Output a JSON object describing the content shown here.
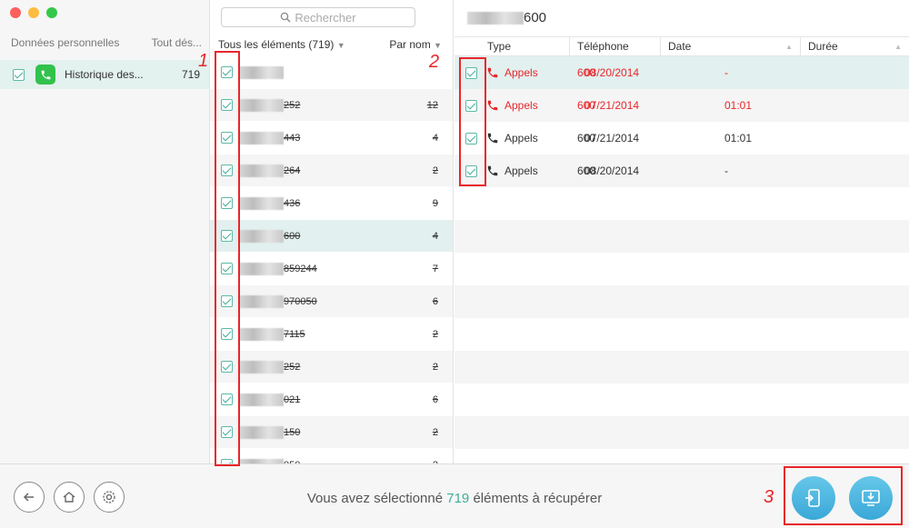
{
  "left": {
    "header_left": "Données personnelles",
    "header_right": "Tout dés...",
    "item": {
      "label": "Historique des...",
      "count": "719"
    }
  },
  "middle": {
    "search_placeholder": "Rechercher",
    "filter_label": "Tous les éléments (719)",
    "sort_label": "Par nom",
    "rows": [
      {
        "num": "",
        "count": ""
      },
      {
        "num": "252",
        "count": "12"
      },
      {
        "num": "443",
        "count": "4"
      },
      {
        "num": "264",
        "count": "2"
      },
      {
        "num": "436",
        "count": "9"
      },
      {
        "num": "600",
        "count": "4"
      },
      {
        "num": "859244",
        "count": "7"
      },
      {
        "num": "970050",
        "count": "6"
      },
      {
        "num": "7115",
        "count": "2"
      },
      {
        "num": "252",
        "count": "2"
      },
      {
        "num": "021",
        "count": "6"
      },
      {
        "num": "150",
        "count": "2"
      },
      {
        "num": "050",
        "count": "2"
      }
    ]
  },
  "right": {
    "title_suffix": "600",
    "columns": {
      "type": "Type",
      "phone": "Téléphone",
      "date": "Date",
      "duration": "Durée"
    },
    "rows": [
      {
        "type": "Appels",
        "phone": "600",
        "date": "08/20/2014",
        "duration": "-",
        "color": "#e8262a"
      },
      {
        "type": "Appels",
        "phone": "600",
        "date": "07/21/2014",
        "duration": "01:01",
        "color": "#e8262a"
      },
      {
        "type": "Appels",
        "phone": "600",
        "date": "07/21/2014",
        "duration": "01:01",
        "color": "#333333"
      },
      {
        "type": "Appels",
        "phone": "600",
        "date": "08/20/2014",
        "duration": "-",
        "color": "#333333"
      }
    ]
  },
  "bottom": {
    "status_before": "Vous avez sélectionné ",
    "status_count": "719",
    "status_after": " éléments à récupérer"
  },
  "annotations": {
    "one": "1",
    "two": "2",
    "three": "3"
  },
  "colors": {
    "accent": "#3fae98",
    "annotation": "#e8262a",
    "action": "#3aa8d8"
  }
}
